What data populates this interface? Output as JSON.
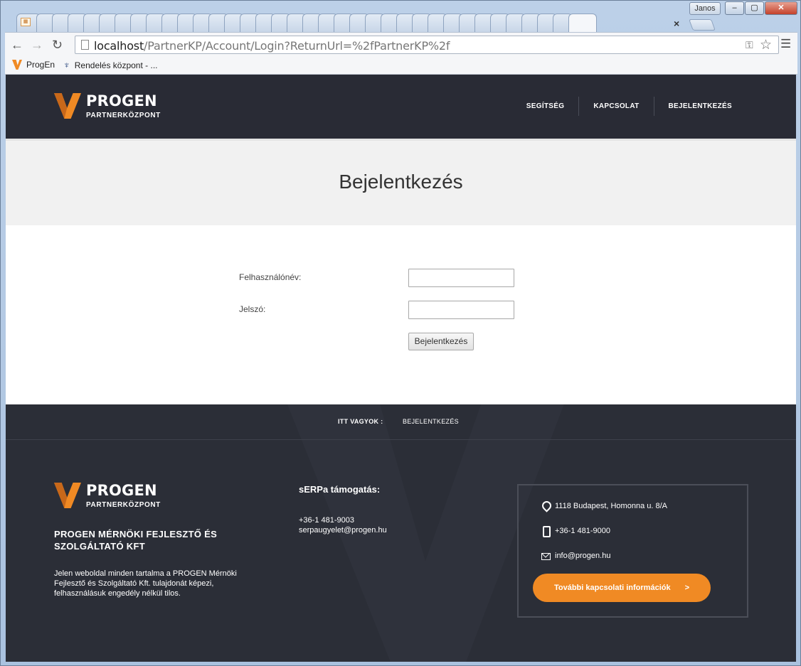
{
  "browser": {
    "user_name": "Janos",
    "minimize": "‒",
    "maximize": "▢",
    "close": "✕",
    "tab_close": "×",
    "url_host": "localhost",
    "url_path": "/PartnerKP/Account/Login?ReturnUrl=%2fPartnerKP%2f",
    "bookmarks": [
      {
        "label": "ProgEn",
        "icon": "progen-v-icon"
      },
      {
        "label": "Rendelés központ - ...",
        "icon": "tree-icon"
      }
    ]
  },
  "header": {
    "logo_name": "PROGEN",
    "logo_sub": "PARTNERKÖZPONT",
    "nav": [
      "SEGÍTSÉG",
      "KAPCSOLAT",
      "BEJELENTKEZÉS"
    ]
  },
  "title_band": {
    "title": "Bejelentkezés"
  },
  "form": {
    "username_label": "Felhasználónév:",
    "username_value": "",
    "password_label": "Jelszó:",
    "password_value": "",
    "submit_label": "Bejelentkezés"
  },
  "footer": {
    "breadcrumb_label": "ITT VAGYOK :",
    "breadcrumb_value": "BEJELENTKEZÉS",
    "logo_name": "PROGEN",
    "logo_sub": "PARTNERKÖZPONT",
    "company_name": "PROGEN MÉRNÖKI FEJLESZTŐ ÉS SZOLGÁLTATÓ KFT",
    "company_desc": "Jelen weboldal minden tartalma a PROGEN Mérnöki Fejlesztő és Szolgáltató Kft. tulajdonát képezi, felhasználásuk engedély nélkül tilos.",
    "support_title": "sERPa támogatás:",
    "support_phone": "+36-1 481-9003",
    "support_email": "serpaugyelet@progen.hu",
    "contact_address": "1118 Budapest, Homonna u. 8/A",
    "contact_phone": "+36-1 481-9000",
    "contact_email": "info@progen.hu",
    "more_label": "További kapcsolati információk",
    "more_arrow": ">"
  },
  "colors": {
    "accent": "#f08a24",
    "header_bg": "#292b35",
    "footer_bg": "#2b2e37"
  }
}
